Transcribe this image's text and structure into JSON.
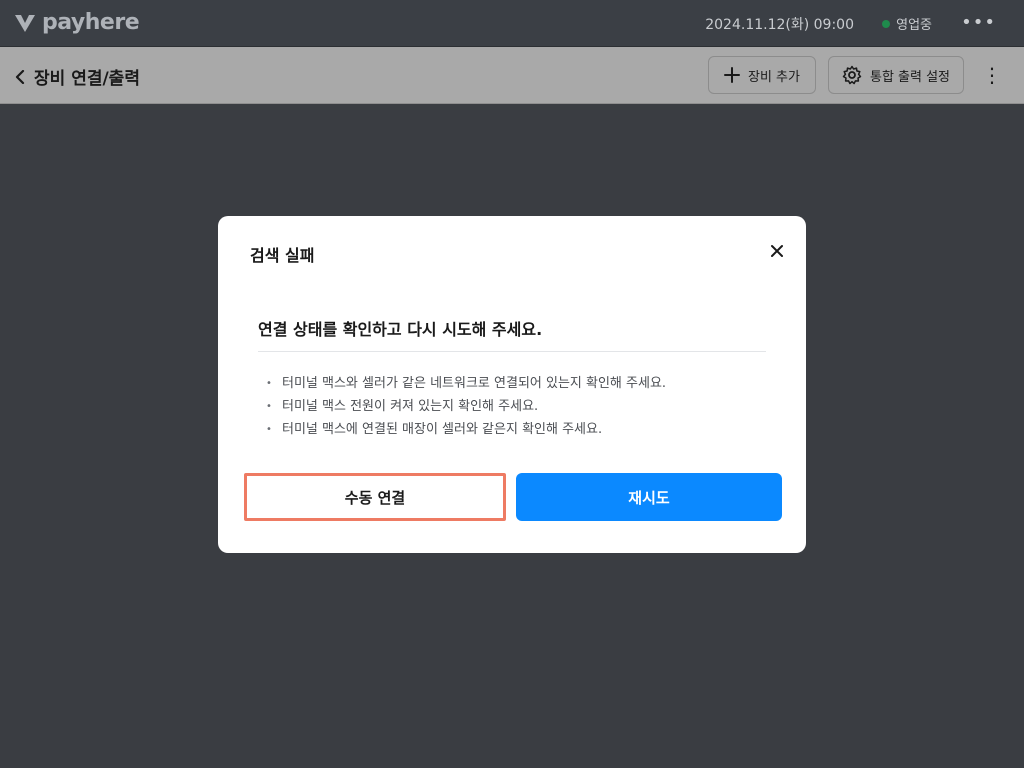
{
  "app": {
    "logo_text": "payhere"
  },
  "topbar": {
    "datetime": "2024.11.12(화) 09:00",
    "status_label": "영업중",
    "status_color": "#1f8a4c",
    "more_icon": "more-horizontal-icon"
  },
  "header": {
    "title": "장비 연결/출력",
    "back_icon": "chevron-left-icon",
    "add_button_label": "장비 추가",
    "add_icon": "plus-icon",
    "print_button_label": "통합 출력 설정",
    "print_icon": "gear-icon",
    "more_icon": "more-vertical-icon"
  },
  "modal": {
    "title": "검색 실패",
    "close_icon": "close-icon",
    "headline": "연결 상태를 확인하고 다시 시도해 주세요.",
    "tips": [
      "터미널 맥스와 셀러가 같은 네트워크로 연결되어 있는지 확인해 주세요.",
      "터미널 맥스 전원이 켜져 있는지 확인해 주세요.",
      "터미널 맥스에 연결된 매장이 셀러와 같은지 확인해 주세요."
    ],
    "manual_button_label": "수동 연결",
    "retry_button_label": "재시도",
    "primary_color": "#0b89ff",
    "highlight_color": "#ee7b63"
  }
}
